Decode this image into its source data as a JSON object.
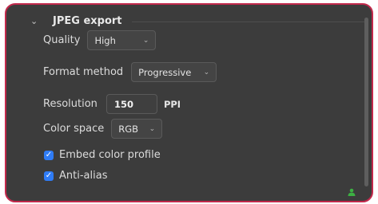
{
  "section": {
    "title": "JPEG export",
    "chevron": "chevron-down-icon"
  },
  "quality": {
    "label": "Quality",
    "value": "High"
  },
  "format": {
    "label": "Format method",
    "value": "Progressive"
  },
  "resolution": {
    "label": "Resolution",
    "value": "150",
    "unit": "PPI"
  },
  "colorspace": {
    "label": "Color space",
    "value": "RGB"
  },
  "embed": {
    "label": "Embed color profile",
    "checked": true
  },
  "antialias": {
    "label": "Anti-alias",
    "checked": true
  },
  "colors": {
    "border": "#c2294c",
    "panel": "#3c3c3c",
    "checkbox": "#2f7cf6",
    "status": "#3cb043"
  },
  "status_icon": "user-icon"
}
